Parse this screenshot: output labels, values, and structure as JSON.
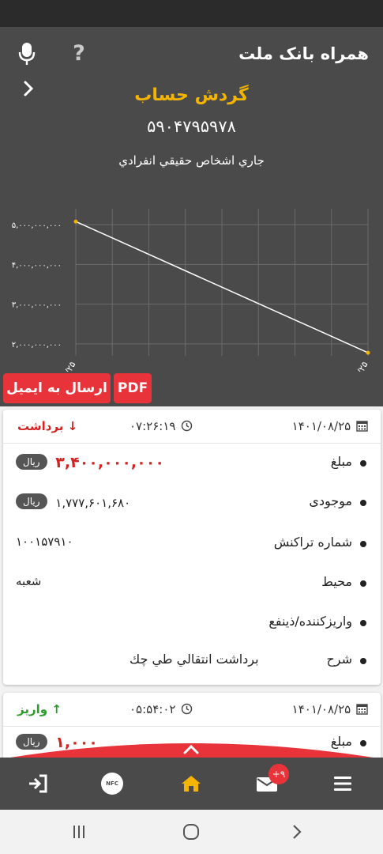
{
  "header": {
    "app_title": "همراه بانک ملت",
    "help_label": "?"
  },
  "account": {
    "page_title": "گردش حساب",
    "number": "۵۹۰۴۷۹۵۹۷۸",
    "type": "جاري اشخاص حقيقي انفرادي"
  },
  "chart_data": {
    "type": "line",
    "x": [
      "۰۸/۲۵",
      "۰۸/۲۵"
    ],
    "series": [
      {
        "values": [
          5077601680,
          1777601680
        ]
      }
    ],
    "y_ticks": [
      "۲,۰۰۰,۰۰۰,۰۰۰",
      "۳,۰۰۰,۰۰۰,۰۰۰",
      "۴,۰۰۰,۰۰۰,۰۰۰",
      "۵,۰۰۰,۰۰۰,۰۰۰"
    ],
    "y_tick_values": [
      2000000000,
      3000000000,
      4000000000,
      5000000000
    ],
    "ylim": [
      1700000000,
      5400000000
    ],
    "grid": true,
    "line_color": "#ffffff",
    "point_color": "#f5b400",
    "title": "",
    "xlabel": "",
    "ylabel": ""
  },
  "actions": {
    "email_label": "ارسال به ايميل",
    "pdf_label": "PDF"
  },
  "transactions": [
    {
      "date": "۱۴۰۱/۰۸/۲۵",
      "time": "۰۷:۲۶:۱۹",
      "type_label": "برداشت",
      "type_arrow": "↓",
      "amount_label": "مبلغ",
      "amount": "۳,۴۰۰,۰۰۰,۰۰۰",
      "currency": "ريال",
      "balance_label": "موجودی",
      "balance": "۱,۷۷۷,۶۰۱,۶۸۰",
      "tx_number_label": "شماره تراکنش",
      "tx_number": "۱۰۰۱۵۷۹۱۰",
      "channel_label": "محیط",
      "channel": "شعبه",
      "party_label": "واریزکننده/ذینفع",
      "desc_label": "شرح",
      "desc": "برداشت انتقالي طي چك"
    },
    {
      "date": "۱۴۰۱/۰۸/۲۵",
      "time": "۰۵:۵۴:۰۲",
      "type_label": "واریز",
      "type_arrow": "↑",
      "amount_label": "مبلغ",
      "amount": "۱,۰۰۰",
      "currency": "ريال"
    }
  ],
  "bottom_nav": {
    "mail_badge": "+۹",
    "nfc_label": "NFC"
  },
  "colors": {
    "accent": "#f5b400",
    "danger": "#e8333a",
    "panel": "#4a4a4a",
    "deposit": "#2e9d2e"
  }
}
